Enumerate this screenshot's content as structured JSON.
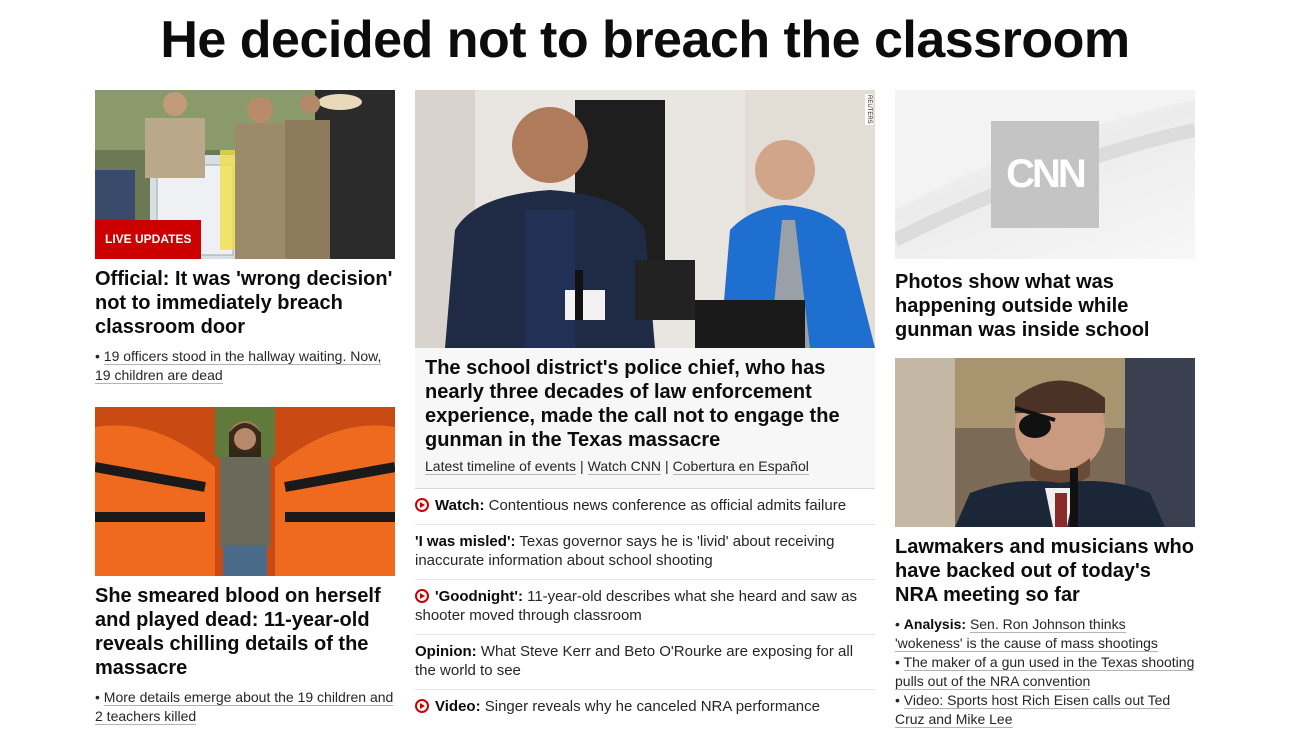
{
  "page": {
    "headline": "He decided not to breach the classroom"
  },
  "left_column": {
    "top_card": {
      "badge": "LIVE UPDATES",
      "title": "Official: It was 'wrong decision' not to immediately breach classroom door",
      "bullet": "19 officers stood in the hallway waiting. Now, 19 children are dead"
    },
    "bottom_card": {
      "title": "She smeared blood on herself and played dead: 11-year-old reveals chilling details of the massacre",
      "bullet": "More details emerge about the 19 children and 2 teachers killed"
    }
  },
  "center_column": {
    "photo_credit": "REUTERS",
    "hero_title": "The school district's police chief, who has nearly three decades of law enforcement experience, made the call not to engage the gunman in the Texas massacre",
    "hero_links": [
      "Latest timeline of events",
      "Watch CNN",
      "Cobertura en Español"
    ],
    "link_separator": "|",
    "stories": [
      {
        "prefix": "Watch:",
        "text": "Contentious news conference as official admits failure",
        "video": true
      },
      {
        "prefix": "'I was misled':",
        "text": "Texas governor says he is 'livid' about receiving inaccurate information about school shooting",
        "video": false
      },
      {
        "prefix": "'Goodnight':",
        "text": "11-year-old describes what she heard and saw as shooter moved through classroom",
        "video": true
      },
      {
        "prefix": "Opinion:",
        "text": "What Steve Kerr and Beto O'Rourke are exposing for all the world to see",
        "video": false
      },
      {
        "prefix": "Video:",
        "text": "Singer reveals why he canceled NRA performance",
        "video": true
      }
    ]
  },
  "right_column": {
    "top_card": {
      "logo_text": "CNN",
      "title": "Photos show what was happening outside while gunman was inside school"
    },
    "bottom_card": {
      "title": "Lawmakers and musicians who have backed out of today's NRA meeting so far",
      "bullets": [
        {
          "prefix": "Analysis:",
          "text": "Sen. Ron Johnson thinks 'wokeness' is the cause of mass shootings"
        },
        {
          "prefix": "",
          "text": "The maker of a gun used in the Texas shooting pulls out of the NRA convention"
        },
        {
          "prefix": "",
          "text": "Video: Sports host Rich Eisen calls out Ted Cruz and Mike Lee"
        }
      ]
    }
  },
  "colors": {
    "accent_red": "#cc0000",
    "text_dark": "#0c0c0c",
    "hero_bg": "#f7f7f7"
  }
}
